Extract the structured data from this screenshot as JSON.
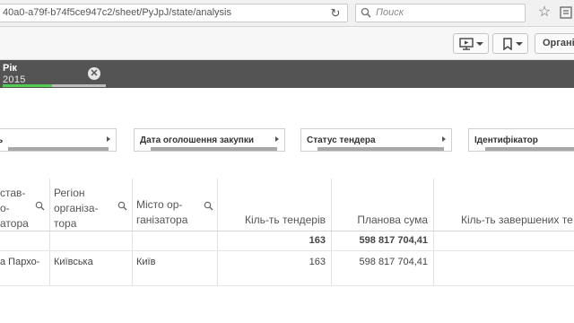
{
  "browser": {
    "url": "40a0-a79f-b74f5ce947c2/sheet/PyJpJ/state/analysis",
    "search_placeholder": "Поиск"
  },
  "toolbar": {
    "org_button_label": "Органі"
  },
  "selections": {
    "field": "Рік",
    "value": "2015"
  },
  "filters": [
    {
      "label": "ь"
    },
    {
      "label": "Дата оголошення закупки"
    },
    {
      "label": "Статус тендера"
    },
    {
      "label": "Ідентифікатор"
    }
  ],
  "table": {
    "headers": {
      "col1": "став-\nо-\nатора",
      "col2": "Регіон\nорганіза-\nтора",
      "col3": "Місто ор-\nганізатора",
      "col4": "Кіль-ть тендерів",
      "col5": "Планова сума",
      "col6": "Кіль-ть завершених те"
    },
    "totals": {
      "tenders": "163",
      "planned_sum": "598 817 704,41"
    },
    "rows": [
      {
        "organizer": "а Пархо-",
        "region": "Київська",
        "city": "Київ",
        "tenders": "163",
        "planned_sum": "598 817 704,41"
      }
    ]
  }
}
